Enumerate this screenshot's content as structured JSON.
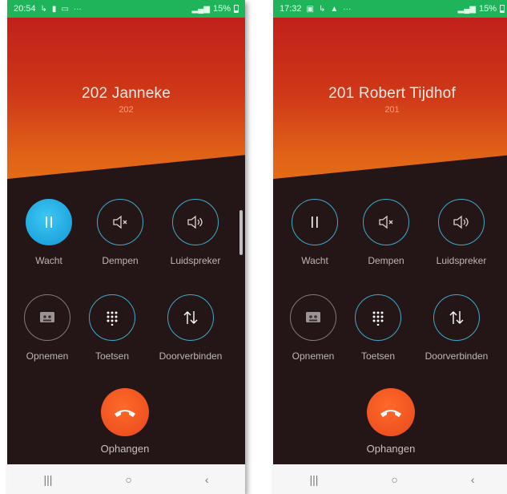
{
  "screens": [
    {
      "status": {
        "time": "20:54",
        "battery": "15%"
      },
      "contact": {
        "name": "202  Janneke",
        "number": "202"
      },
      "buttons": {
        "hold": "Wacht",
        "mute": "Dempen",
        "speaker": "Luidspreker",
        "record": "Opnemen",
        "keypad": "Toetsen",
        "transfer": "Doorverbinden"
      },
      "hangup": "Ophangen"
    },
    {
      "status": {
        "time": "17:32",
        "battery": "15%"
      },
      "contact": {
        "name": "201 Robert Tijdhof",
        "number": "201"
      },
      "buttons": {
        "hold": "Wacht",
        "mute": "Dempen",
        "speaker": "Luidspreker",
        "record": "Opnemen",
        "keypad": "Toetsen",
        "transfer": "Doorverbinden"
      },
      "hangup": "Ophangen"
    }
  ],
  "nav": {
    "recent": "|||",
    "home": "○",
    "back": "‹"
  },
  "colors": {
    "status_bar": "#1fb45a",
    "hero_top": "#c0201a",
    "hero_bottom": "#e57016",
    "accent": "#3fa9c9",
    "hangup": "#f05a22",
    "hold_active": "#1fa8e6"
  }
}
